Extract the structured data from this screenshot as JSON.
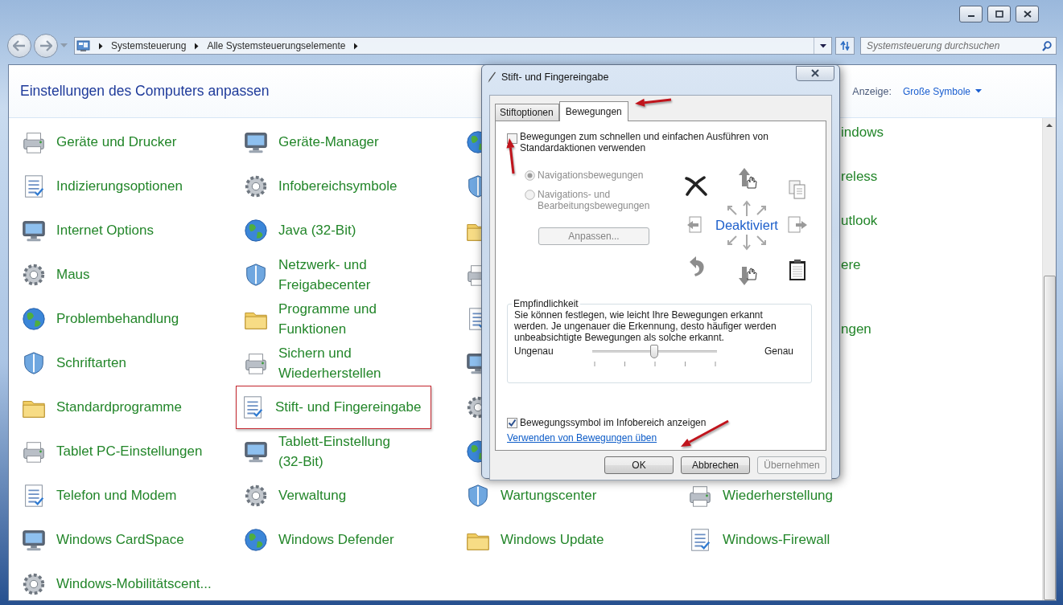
{
  "nav": {
    "breadcrumbs": [
      "Systemsteuerung",
      "Alle Systemsteuerungselemente"
    ],
    "search": {
      "placeholder": "Systemsteuerung durchsuchen"
    }
  },
  "header": {
    "title": "Einstellungen des Computers anpassen",
    "view_label": "Anzeige:",
    "view_value": "Große Symbole"
  },
  "grid": {
    "rows": [
      {
        "cells": [
          {
            "kind": "full",
            "label": "Geräte und Drucker",
            "highlighted": false
          },
          {
            "kind": "full",
            "label": "Geräte-Manager",
            "highlighted": false
          },
          {
            "kind": "icon_only"
          },
          {
            "kind": "cut_first_line",
            "label": "indows"
          }
        ]
      },
      {
        "cells": [
          {
            "kind": "full",
            "label": "Indizierungsoptionen",
            "highlighted": false
          },
          {
            "kind": "full",
            "label": "Infobereichsymbole",
            "highlighted": false
          },
          {
            "kind": "icon_only"
          },
          {
            "kind": "cut_first_line",
            "label": "reless"
          }
        ]
      },
      {
        "cells": [
          {
            "kind": "full",
            "label": "Internet Options",
            "highlighted": false
          },
          {
            "kind": "full",
            "label": "Java (32-Bit)",
            "highlighted": false
          },
          {
            "kind": "icon_only"
          },
          {
            "kind": "cut_first_line",
            "label": "utlook"
          }
        ]
      },
      {
        "cells": [
          {
            "kind": "full",
            "label": "Maus",
            "highlighted": false
          },
          {
            "kind": "full",
            "label": "Netzwerk- und\nFreigabecenter",
            "highlighted": false
          },
          {
            "kind": "icon_only"
          },
          {
            "kind": "cut_first_line",
            "label": "ere"
          }
        ]
      },
      {
        "cells": [
          {
            "kind": "full",
            "label": "Problembehandlung",
            "highlighted": false
          },
          {
            "kind": "full",
            "label": "Programme und\nFunktionen",
            "highlighted": false
          },
          {
            "kind": "icon_only"
          },
          {
            "kind": "cut_second_line",
            "label": "ngen"
          }
        ]
      },
      {
        "cells": [
          {
            "kind": "full",
            "label": "Schriftarten",
            "highlighted": false
          },
          {
            "kind": "full",
            "label": "Sichern und\nWiederherstellen",
            "highlighted": false
          },
          {
            "kind": "icon_only"
          }
        ]
      },
      {
        "cells": [
          {
            "kind": "full",
            "label": "Standardprogramme",
            "highlighted": false
          },
          {
            "kind": "full",
            "label": "Stift- und Fingereingabe",
            "highlighted": true
          },
          {
            "kind": "icon_only"
          }
        ]
      },
      {
        "cells": [
          {
            "kind": "full",
            "label": "Tablet PC-Einstellungen",
            "highlighted": false
          },
          {
            "kind": "full",
            "label": "Tablett-Einstellung\n(32-Bit)",
            "highlighted": false
          },
          {
            "kind": "icon_only"
          }
        ]
      },
      {
        "cells": [
          {
            "kind": "full",
            "label": "Telefon und Modem",
            "highlighted": false
          },
          {
            "kind": "full",
            "label": "Verwaltung",
            "highlighted": false
          },
          {
            "kind": "full",
            "label": "Wartungscenter",
            "highlighted": false
          },
          {
            "kind": "full",
            "label": "Wiederherstellung",
            "highlighted": false
          }
        ]
      },
      {
        "cells": [
          {
            "kind": "full",
            "label": "Windows CardSpace",
            "highlighted": false
          },
          {
            "kind": "full",
            "label": "Windows Defender",
            "highlighted": false
          },
          {
            "kind": "full",
            "label": "Windows Update",
            "highlighted": false
          },
          {
            "kind": "full",
            "label": "Windows-Firewall",
            "highlighted": false
          }
        ]
      },
      {
        "cells": [
          {
            "kind": "full",
            "label": "Windows-Mobilitätscent...",
            "highlighted": false
          }
        ]
      }
    ]
  },
  "dialog": {
    "title": "Stift- und Fingereingabe",
    "tabs": [
      {
        "label": "Stiftoptionen",
        "selected": false
      },
      {
        "label": "Bewegungen",
        "selected": true
      }
    ],
    "gestures_checkbox": {
      "label": "Bewegungen zum schnellen und einfachen Ausführen von Standardaktionen verwenden",
      "checked": false
    },
    "gesture_modes": [
      {
        "label": "Navigationsbewegungen",
        "selected": true,
        "disabled": true
      },
      {
        "label": "Navigations- und Bearbeitungsbewegungen",
        "selected": false,
        "disabled": true
      }
    ],
    "customize_button": {
      "label": "Anpassen...",
      "disabled": true
    },
    "gesture_status": "Deaktiviert",
    "sensitivity": {
      "title": "Empfindlichkeit",
      "description": "Sie können festlegen, wie leicht Ihre Bewegungen erkannt\nwerden. Je ungenauer die Erkennung, desto häufiger werden\nunbeabsichtigte Bewegungen als solche erkannt.",
      "min_label": "Ungenau",
      "max_label": "Genau",
      "level": 0.5
    },
    "tray_checkbox": {
      "label": "Bewegungssymbol im Infobereich anzeigen",
      "checked": true
    },
    "practice_link": "Verwenden von Bewegungen üben",
    "buttons": [
      {
        "label": "OK",
        "disabled": false
      },
      {
        "label": "Abbrechen",
        "disabled": false
      },
      {
        "label": "Übernehmen",
        "disabled": true
      }
    ]
  }
}
